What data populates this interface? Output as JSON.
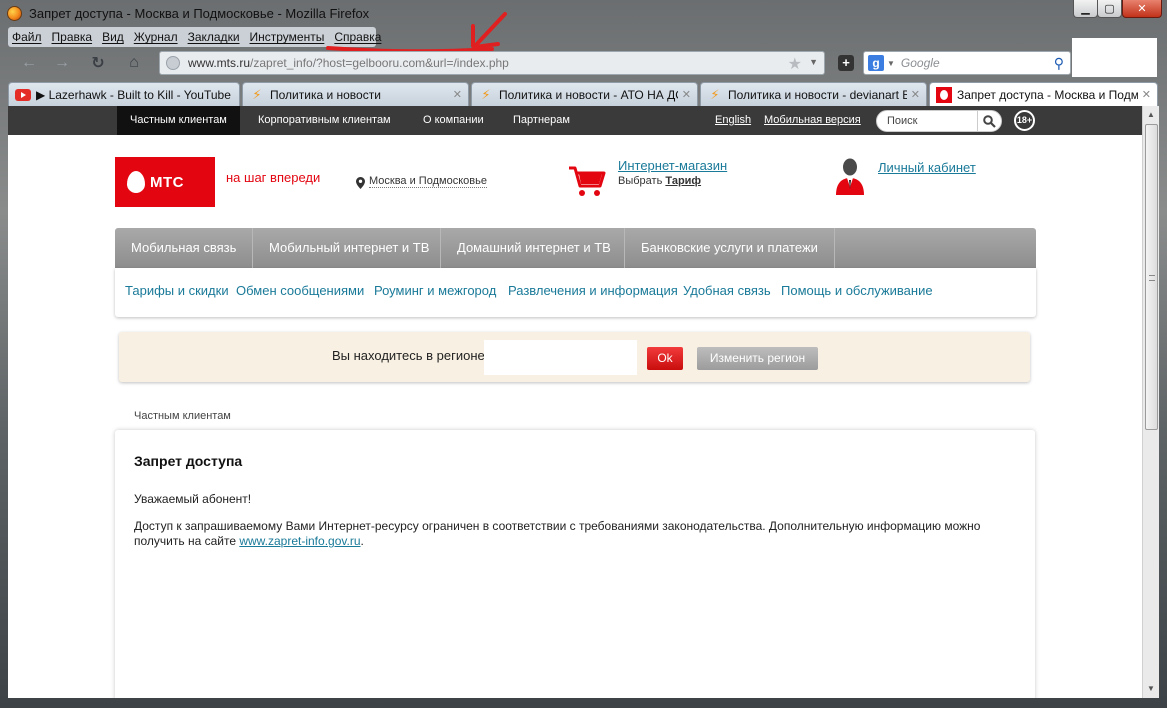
{
  "window": {
    "title": "Запрет доступа - Москва и Подмосковье - Mozilla Firefox"
  },
  "menu": [
    "Файл",
    "Правка",
    "Вид",
    "Журнал",
    "Закладки",
    "Инструменты",
    "Справка"
  ],
  "urlbar": {
    "host": "www.mts.ru",
    "path": "/zapret_info/?host=gelbooru.com&url=/index.php"
  },
  "searchbar": {
    "placeholder": "Google"
  },
  "tabs": [
    {
      "label": "▶ Lazerhawk - Built to Kill - YouTube",
      "icon": "youtube-icon",
      "active": false
    },
    {
      "label": "Политика и новости",
      "icon": "lightning-icon",
      "active": false
    },
    {
      "label": "Политика и новости - АТО НА ДОН...",
      "icon": "lightning-icon",
      "active": false
    },
    {
      "label": "Политика и новости - devianart ВСЁ",
      "icon": "lightning-icon",
      "active": false
    },
    {
      "label": "Запрет доступа - Москва и Подмос...",
      "icon": "mts-icon",
      "active": true
    }
  ],
  "site": {
    "topnav": [
      "Частным клиентам",
      "Корпоративным клиентам",
      "О компании",
      "Партнерам"
    ],
    "english": "English",
    "mobile_version": "Мобильная версия",
    "search_placeholder": "Поиск",
    "age_badge": "18+",
    "logo_text": "МТС",
    "slogan": "на шаг впереди",
    "region": "Москва и Подмосковье",
    "shop_link": "Интернет-магазин",
    "shop_sub_prefix": "Выбрать",
    "shop_sub_bold": "Тариф",
    "cabinet_link": "Личный кабинет",
    "mainnav": [
      "Мобильная связь",
      "Мобильный интернет и ТВ",
      "Домашний интернет и ТВ",
      "Банковские услуги и платежи"
    ],
    "subnav": [
      "Тарифы и скидки",
      "Обмен сообщениями",
      "Роуминг и межгород",
      "Развлечения и информация",
      "Удобная связь",
      "Помощь и обслуживание"
    ],
    "region_question": "Вы находитесь в регионе",
    "ok_button": "Ok",
    "change_region_button": "Изменить регион",
    "breadcrumb": "Частным клиентам",
    "card": {
      "title": "Запрет доступа",
      "greeting": "Уважаемый абонент!",
      "body": "Доступ к запрашиваемому Вами Интернет-ресурсу ограничен в соответствии с требованиями законодательства. Дополнительную информацию можно получить на сайте ",
      "link": "www.zapret-info.gov.ru",
      "tail": "."
    }
  },
  "colors": {
    "brand_red": "#e30611",
    "link": "#1a7a99",
    "topbar": "#3a3a3a"
  }
}
